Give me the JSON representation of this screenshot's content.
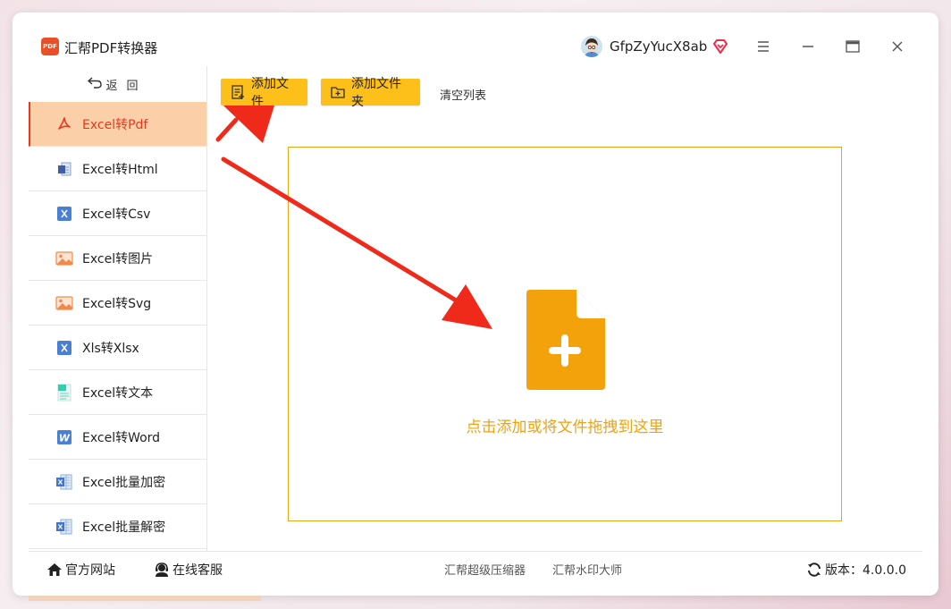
{
  "app": {
    "title": "汇帮PDF转换器",
    "logo_text": "PDF"
  },
  "user": {
    "name": "GfpZyYucX8ab"
  },
  "sidebar": {
    "back_label": "返回",
    "items": [
      {
        "label": "Excel转Pdf",
        "icon": "pdf-icon",
        "active": true
      },
      {
        "label": "Excel转Html",
        "icon": "html-icon"
      },
      {
        "label": "Excel转Csv",
        "icon": "excel-x-icon"
      },
      {
        "label": "Excel转图片",
        "icon": "image-icon"
      },
      {
        "label": "Excel转Svg",
        "icon": "image-icon"
      },
      {
        "label": "Xls转Xlsx",
        "icon": "excel-x-icon"
      },
      {
        "label": "Excel转文本",
        "icon": "text-icon"
      },
      {
        "label": "Excel转Word",
        "icon": "word-icon"
      },
      {
        "label": "Excel批量加密",
        "icon": "excel-file-icon"
      },
      {
        "label": "Excel批量解密",
        "icon": "excel-file-icon"
      }
    ]
  },
  "toolbar": {
    "add_file": "添加文件",
    "add_folder": "添加文件夹",
    "clear_list": "清空列表"
  },
  "dropzone": {
    "text": "点击添加或将文件拖拽到这里"
  },
  "footer": {
    "official_site": "官方网站",
    "online_service": "在线客服",
    "compressor": "汇帮超级压缩器",
    "watermark": "汇帮水印大师",
    "version": "版本：4.0.0.0"
  },
  "colors": {
    "accent_yellow": "#fdbf1a",
    "active_bg": "#fbd0a8",
    "active_text": "#e8381e",
    "drop_orange": "#f0a20f",
    "arrow_red": "#f02a1a"
  }
}
